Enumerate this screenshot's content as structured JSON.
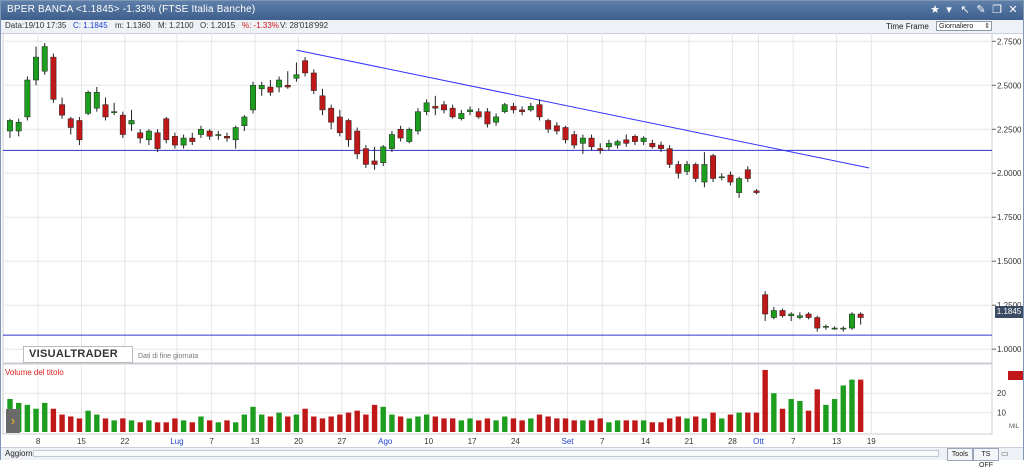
{
  "window": {
    "title": "BPER BANCA <1.1845> -1.33%  (FTSE Italia Banche)",
    "icons": [
      "star-icon",
      "dropdown-icon",
      "pin-icon",
      "tool-icon",
      "restore-icon",
      "close-icon"
    ]
  },
  "infobar": {
    "date": "Data:19/10 17:35",
    "close_label": "C: 1.1845",
    "min_label": "m: 1.1360",
    "max_label": "M: 1.2100",
    "open_label": "O: 1.2015",
    "change_label": "%: -1.33%",
    "volume_label": "V: 28'018'992",
    "timeframe_label": "Time Frame",
    "timeframe_value": "Giornaliero"
  },
  "logo": {
    "text": "VISUALTRADER",
    "sub": "Dati di fine giornata"
  },
  "current_price": "1.1845",
  "volume_panel": {
    "title": "Volume del titolo",
    "unit": "MIL"
  },
  "status": {
    "refresh": "Aggiorna",
    "tools": "Tools",
    "ts": "TS OFF"
  },
  "colors": {
    "up": "#1e9e1e",
    "down": "#c01818",
    "trendline": "#3333ff",
    "horizontal": "#3333cc",
    "grid": "#e6e6e6"
  },
  "chart_data": {
    "type": "candlestick",
    "price_axis": {
      "ticks": [
        "2.7500",
        "2.5000",
        "2.2500",
        "2.0000",
        "1.7500",
        "1.5000",
        "1.2500",
        "1.0000"
      ],
      "ylim": [
        0.95,
        2.78
      ]
    },
    "volume_axis": {
      "ticks": [
        "20",
        "10"
      ],
      "ylim": [
        0,
        33
      ]
    },
    "x_ticks": [
      {
        "i": 3,
        "label": "8"
      },
      {
        "i": 8,
        "label": "15"
      },
      {
        "i": 13,
        "label": "22"
      },
      {
        "i": 19,
        "label": "Lug",
        "month": true
      },
      {
        "i": 23,
        "label": "7"
      },
      {
        "i": 28,
        "label": "13"
      },
      {
        "i": 33,
        "label": "20"
      },
      {
        "i": 38,
        "label": "27"
      },
      {
        "i": 43,
        "label": "Ago",
        "month": true
      },
      {
        "i": 48,
        "label": "10"
      },
      {
        "i": 53,
        "label": "17"
      },
      {
        "i": 58,
        "label": "24"
      },
      {
        "i": 64,
        "label": "Set",
        "month": true
      },
      {
        "i": 68,
        "label": "7"
      },
      {
        "i": 73,
        "label": "14"
      },
      {
        "i": 78,
        "label": "21"
      },
      {
        "i": 83,
        "label": "28"
      },
      {
        "i": 86,
        "label": "Ott",
        "month": true
      },
      {
        "i": 90,
        "label": "7"
      },
      {
        "i": 95,
        "label": "13"
      },
      {
        "i": 99,
        "label": "19"
      }
    ],
    "candles": [
      {
        "o": 2.24,
        "h": 2.31,
        "l": 2.2,
        "c": 2.3,
        "v": 17
      },
      {
        "o": 2.24,
        "h": 2.31,
        "l": 2.21,
        "c": 2.29,
        "v": 15
      },
      {
        "o": 2.32,
        "h": 2.55,
        "l": 2.3,
        "c": 2.53,
        "v": 14
      },
      {
        "o": 2.53,
        "h": 2.72,
        "l": 2.5,
        "c": 2.66,
        "v": 12
      },
      {
        "o": 2.58,
        "h": 2.74,
        "l": 2.56,
        "c": 2.72,
        "v": 15
      },
      {
        "o": 2.66,
        "h": 2.68,
        "l": 2.4,
        "c": 2.42,
        "v": 12
      },
      {
        "o": 2.39,
        "h": 2.43,
        "l": 2.31,
        "c": 2.33,
        "v": 9
      },
      {
        "o": 2.31,
        "h": 2.32,
        "l": 2.22,
        "c": 2.26,
        "v": 8
      },
      {
        "o": 2.3,
        "h": 2.32,
        "l": 2.16,
        "c": 2.19,
        "v": 7
      },
      {
        "o": 2.34,
        "h": 2.47,
        "l": 2.33,
        "c": 2.46,
        "v": 11
      },
      {
        "o": 2.37,
        "h": 2.49,
        "l": 2.35,
        "c": 2.46,
        "v": 9
      },
      {
        "o": 2.39,
        "h": 2.43,
        "l": 2.3,
        "c": 2.32,
        "v": 7
      },
      {
        "o": 2.35,
        "h": 2.4,
        "l": 2.33,
        "c": 2.35,
        "v": 6
      },
      {
        "o": 2.33,
        "h": 2.35,
        "l": 2.2,
        "c": 2.22,
        "v": 7
      },
      {
        "o": 2.28,
        "h": 2.36,
        "l": 2.24,
        "c": 2.3,
        "v": 6
      },
      {
        "o": 2.23,
        "h": 2.25,
        "l": 2.17,
        "c": 2.2,
        "v": 5
      },
      {
        "o": 2.19,
        "h": 2.25,
        "l": 2.16,
        "c": 2.24,
        "v": 6
      },
      {
        "o": 2.23,
        "h": 2.25,
        "l": 2.12,
        "c": 2.14,
        "v": 5
      },
      {
        "o": 2.31,
        "h": 2.32,
        "l": 2.17,
        "c": 2.19,
        "v": 5
      },
      {
        "o": 2.21,
        "h": 2.23,
        "l": 2.14,
        "c": 2.16,
        "v": 7
      },
      {
        "o": 2.16,
        "h": 2.22,
        "l": 2.14,
        "c": 2.2,
        "v": 6
      },
      {
        "o": 2.2,
        "h": 2.23,
        "l": 2.16,
        "c": 2.18,
        "v": 5
      },
      {
        "o": 2.22,
        "h": 2.27,
        "l": 2.2,
        "c": 2.25,
        "v": 8
      },
      {
        "o": 2.24,
        "h": 2.25,
        "l": 2.19,
        "c": 2.21,
        "v": 6
      },
      {
        "o": 2.22,
        "h": 2.24,
        "l": 2.19,
        "c": 2.22,
        "v": 5
      },
      {
        "o": 2.21,
        "h": 2.23,
        "l": 2.18,
        "c": 2.2,
        "v": 6
      },
      {
        "o": 2.19,
        "h": 2.27,
        "l": 2.14,
        "c": 2.26,
        "v": 5
      },
      {
        "o": 2.27,
        "h": 2.33,
        "l": 2.24,
        "c": 2.32,
        "v": 9
      },
      {
        "o": 2.36,
        "h": 2.52,
        "l": 2.34,
        "c": 2.5,
        "v": 13
      },
      {
        "o": 2.48,
        "h": 2.52,
        "l": 2.44,
        "c": 2.5,
        "v": 9
      },
      {
        "o": 2.49,
        "h": 2.53,
        "l": 2.44,
        "c": 2.46,
        "v": 8
      },
      {
        "o": 2.49,
        "h": 2.55,
        "l": 2.46,
        "c": 2.53,
        "v": 10
      },
      {
        "o": 2.5,
        "h": 2.58,
        "l": 2.48,
        "c": 2.49,
        "v": 8
      },
      {
        "o": 2.54,
        "h": 2.63,
        "l": 2.52,
        "c": 2.56,
        "v": 9
      },
      {
        "o": 2.64,
        "h": 2.66,
        "l": 2.55,
        "c": 2.57,
        "v": 12
      },
      {
        "o": 2.57,
        "h": 2.59,
        "l": 2.45,
        "c": 2.47,
        "v": 8
      },
      {
        "o": 2.44,
        "h": 2.48,
        "l": 2.33,
        "c": 2.36,
        "v": 7
      },
      {
        "o": 2.37,
        "h": 2.39,
        "l": 2.25,
        "c": 2.29,
        "v": 8
      },
      {
        "o": 2.32,
        "h": 2.36,
        "l": 2.21,
        "c": 2.23,
        "v": 9
      },
      {
        "o": 2.3,
        "h": 2.31,
        "l": 2.15,
        "c": 2.19,
        "v": 10
      },
      {
        "o": 2.24,
        "h": 2.26,
        "l": 2.08,
        "c": 2.11,
        "v": 11
      },
      {
        "o": 2.14,
        "h": 2.16,
        "l": 2.03,
        "c": 2.05,
        "v": 9
      },
      {
        "o": 2.07,
        "h": 2.15,
        "l": 2.02,
        "c": 2.05,
        "v": 14
      },
      {
        "o": 2.06,
        "h": 2.16,
        "l": 2.04,
        "c": 2.15,
        "v": 13
      },
      {
        "o": 2.14,
        "h": 2.24,
        "l": 2.12,
        "c": 2.22,
        "v": 9
      },
      {
        "o": 2.25,
        "h": 2.27,
        "l": 2.18,
        "c": 2.2,
        "v": 8
      },
      {
        "o": 2.18,
        "h": 2.26,
        "l": 2.17,
        "c": 2.25,
        "v": 7
      },
      {
        "o": 2.24,
        "h": 2.37,
        "l": 2.22,
        "c": 2.35,
        "v": 8
      },
      {
        "o": 2.35,
        "h": 2.42,
        "l": 2.33,
        "c": 2.4,
        "v": 9
      },
      {
        "o": 2.38,
        "h": 2.44,
        "l": 2.33,
        "c": 2.37,
        "v": 8
      },
      {
        "o": 2.39,
        "h": 2.41,
        "l": 2.34,
        "c": 2.36,
        "v": 7
      },
      {
        "o": 2.37,
        "h": 2.39,
        "l": 2.31,
        "c": 2.32,
        "v": 7
      },
      {
        "o": 2.31,
        "h": 2.36,
        "l": 2.3,
        "c": 2.34,
        "v": 6
      },
      {
        "o": 2.35,
        "h": 2.38,
        "l": 2.33,
        "c": 2.36,
        "v": 7
      },
      {
        "o": 2.35,
        "h": 2.37,
        "l": 2.31,
        "c": 2.32,
        "v": 6
      },
      {
        "o": 2.35,
        "h": 2.37,
        "l": 2.26,
        "c": 2.28,
        "v": 7
      },
      {
        "o": 2.29,
        "h": 2.34,
        "l": 2.27,
        "c": 2.32,
        "v": 6
      },
      {
        "o": 2.35,
        "h": 2.4,
        "l": 2.34,
        "c": 2.39,
        "v": 8
      },
      {
        "o": 2.38,
        "h": 2.4,
        "l": 2.34,
        "c": 2.36,
        "v": 7
      },
      {
        "o": 2.36,
        "h": 2.38,
        "l": 2.33,
        "c": 2.35,
        "v": 6
      },
      {
        "o": 2.36,
        "h": 2.4,
        "l": 2.35,
        "c": 2.38,
        "v": 7
      },
      {
        "o": 2.39,
        "h": 2.42,
        "l": 2.3,
        "c": 2.32,
        "v": 9
      },
      {
        "o": 2.3,
        "h": 2.31,
        "l": 2.23,
        "c": 2.25,
        "v": 8
      },
      {
        "o": 2.27,
        "h": 2.29,
        "l": 2.22,
        "c": 2.24,
        "v": 7
      },
      {
        "o": 2.26,
        "h": 2.27,
        "l": 2.17,
        "c": 2.19,
        "v": 7
      },
      {
        "o": 2.22,
        "h": 2.24,
        "l": 2.14,
        "c": 2.16,
        "v": 6
      },
      {
        "o": 2.17,
        "h": 2.22,
        "l": 2.11,
        "c": 2.2,
        "v": 6
      },
      {
        "o": 2.2,
        "h": 2.22,
        "l": 2.13,
        "c": 2.15,
        "v": 6
      },
      {
        "o": 2.14,
        "h": 2.17,
        "l": 2.11,
        "c": 2.13,
        "v": 7
      },
      {
        "o": 2.15,
        "h": 2.19,
        "l": 2.13,
        "c": 2.17,
        "v": 5
      },
      {
        "o": 2.16,
        "h": 2.19,
        "l": 2.14,
        "c": 2.18,
        "v": 6
      },
      {
        "o": 2.19,
        "h": 2.22,
        "l": 2.15,
        "c": 2.17,
        "v": 6
      },
      {
        "o": 2.21,
        "h": 2.22,
        "l": 2.16,
        "c": 2.18,
        "v": 6
      },
      {
        "o": 2.18,
        "h": 2.21,
        "l": 2.16,
        "c": 2.2,
        "v": 6
      },
      {
        "o": 2.17,
        "h": 2.19,
        "l": 2.14,
        "c": 2.15,
        "v": 5
      },
      {
        "o": 2.16,
        "h": 2.18,
        "l": 2.12,
        "c": 2.14,
        "v": 5
      },
      {
        "o": 2.14,
        "h": 2.16,
        "l": 2.03,
        "c": 2.05,
        "v": 7
      },
      {
        "o": 2.05,
        "h": 2.07,
        "l": 1.97,
        "c": 2.0,
        "v": 8
      },
      {
        "o": 2.01,
        "h": 2.07,
        "l": 1.99,
        "c": 2.05,
        "v": 7
      },
      {
        "o": 2.05,
        "h": 2.06,
        "l": 1.95,
        "c": 1.97,
        "v": 8
      },
      {
        "o": 1.95,
        "h": 2.12,
        "l": 1.92,
        "c": 2.05,
        "v": 7
      },
      {
        "o": 2.1,
        "h": 2.11,
        "l": 1.95,
        "c": 1.97,
        "v": 10
      },
      {
        "o": 1.98,
        "h": 2.0,
        "l": 1.96,
        "c": 1.98,
        "v": 7
      },
      {
        "o": 1.99,
        "h": 2.01,
        "l": 1.93,
        "c": 1.95,
        "v": 9
      },
      {
        "o": 1.89,
        "h": 1.98,
        "l": 1.86,
        "c": 1.97,
        "v": 10
      },
      {
        "o": 2.02,
        "h": 2.04,
        "l": 1.95,
        "c": 1.97,
        "v": 10
      },
      {
        "o": 1.9,
        "h": 1.91,
        "l": 1.88,
        "c": 1.89,
        "v": 10
      },
      {
        "o": 1.31,
        "h": 1.33,
        "l": 1.16,
        "c": 1.2,
        "v": 32
      },
      {
        "o": 1.18,
        "h": 1.24,
        "l": 1.17,
        "c": 1.22,
        "v": 20
      },
      {
        "o": 1.22,
        "h": 1.23,
        "l": 1.18,
        "c": 1.19,
        "v": 12
      },
      {
        "o": 1.19,
        "h": 1.21,
        "l": 1.16,
        "c": 1.2,
        "v": 17
      },
      {
        "o": 1.18,
        "h": 1.21,
        "l": 1.17,
        "c": 1.19,
        "v": 16
      },
      {
        "o": 1.2,
        "h": 1.21,
        "l": 1.17,
        "c": 1.18,
        "v": 11
      },
      {
        "o": 1.18,
        "h": 1.19,
        "l": 1.1,
        "c": 1.12,
        "v": 22
      },
      {
        "o": 1.13,
        "h": 1.14,
        "l": 1.11,
        "c": 1.13,
        "v": 14
      },
      {
        "o": 1.12,
        "h": 1.13,
        "l": 1.11,
        "c": 1.12,
        "v": 17
      },
      {
        "o": 1.12,
        "h": 1.13,
        "l": 1.1,
        "c": 1.12,
        "v": 24
      },
      {
        "o": 1.12,
        "h": 1.21,
        "l": 1.11,
        "c": 1.2,
        "v": 27
      },
      {
        "o": 1.2,
        "h": 1.21,
        "l": 1.14,
        "c": 1.18,
        "v": 27
      }
    ],
    "trendline": {
      "from": {
        "i": 33,
        "price": 2.7
      },
      "to": {
        "i": 99,
        "price": 2.03
      }
    },
    "support_line": 2.13,
    "lower_line": 1.08
  }
}
